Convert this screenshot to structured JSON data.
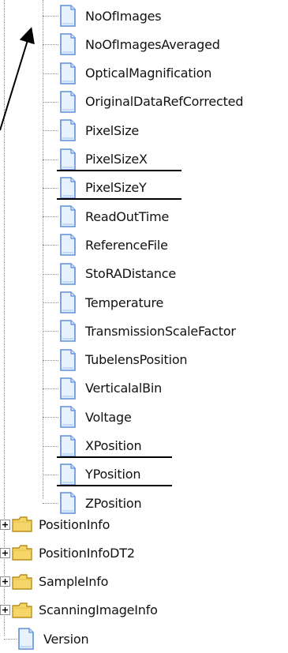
{
  "tree": {
    "child_nodes": [
      {
        "label": "NoOfImages",
        "icon": "document-icon"
      },
      {
        "label": "NoOfImagesAveraged",
        "icon": "document-icon"
      },
      {
        "label": "OpticalMagnification",
        "icon": "document-icon"
      },
      {
        "label": "OriginalDataRefCorrected",
        "icon": "document-icon"
      },
      {
        "label": "PixelSize",
        "icon": "document-icon"
      },
      {
        "label": "PixelSizeX",
        "icon": "document-icon",
        "underlined": true
      },
      {
        "label": "PixelSizeY",
        "icon": "document-icon",
        "underlined": true
      },
      {
        "label": "ReadOutTime",
        "icon": "document-icon"
      },
      {
        "label": "ReferenceFile",
        "icon": "document-icon"
      },
      {
        "label": "StoRADistance",
        "icon": "document-icon"
      },
      {
        "label": "Temperature",
        "icon": "document-icon"
      },
      {
        "label": "TransmissionScaleFactor",
        "icon": "document-icon"
      },
      {
        "label": "TubelensPosition",
        "icon": "document-icon"
      },
      {
        "label": "VerticalalBin",
        "icon": "document-icon"
      },
      {
        "label": "Voltage",
        "icon": "document-icon"
      },
      {
        "label": "XPosition",
        "icon": "document-icon",
        "underlined": true
      },
      {
        "label": "YPosition",
        "icon": "document-icon",
        "underlined": true
      },
      {
        "label": "ZPosition",
        "icon": "document-icon"
      }
    ],
    "folder_nodes": [
      {
        "label": "PositionInfo",
        "icon": "folder-icon",
        "expander": "plus-icon"
      },
      {
        "label": "PositionInfoDT2",
        "icon": "folder-icon",
        "expander": "plus-icon"
      },
      {
        "label": "SampleInfo",
        "icon": "folder-icon",
        "expander": "plus-icon"
      },
      {
        "label": "ScanningImageInfo",
        "icon": "folder-icon",
        "expander": "plus-icon"
      }
    ],
    "last_node": {
      "label": "Version",
      "icon": "document-icon"
    }
  },
  "annotation": {
    "arrow_icon": "arrow-icon",
    "underline_color": "#000000"
  },
  "colors": {
    "page_background": "#ffffff",
    "tree_line": "#8f8f8f",
    "document_fill": "#e8f2ff",
    "document_edge": "#5f8fd6",
    "folder_fill": "#f5d66b",
    "folder_edge": "#b88d1b"
  }
}
